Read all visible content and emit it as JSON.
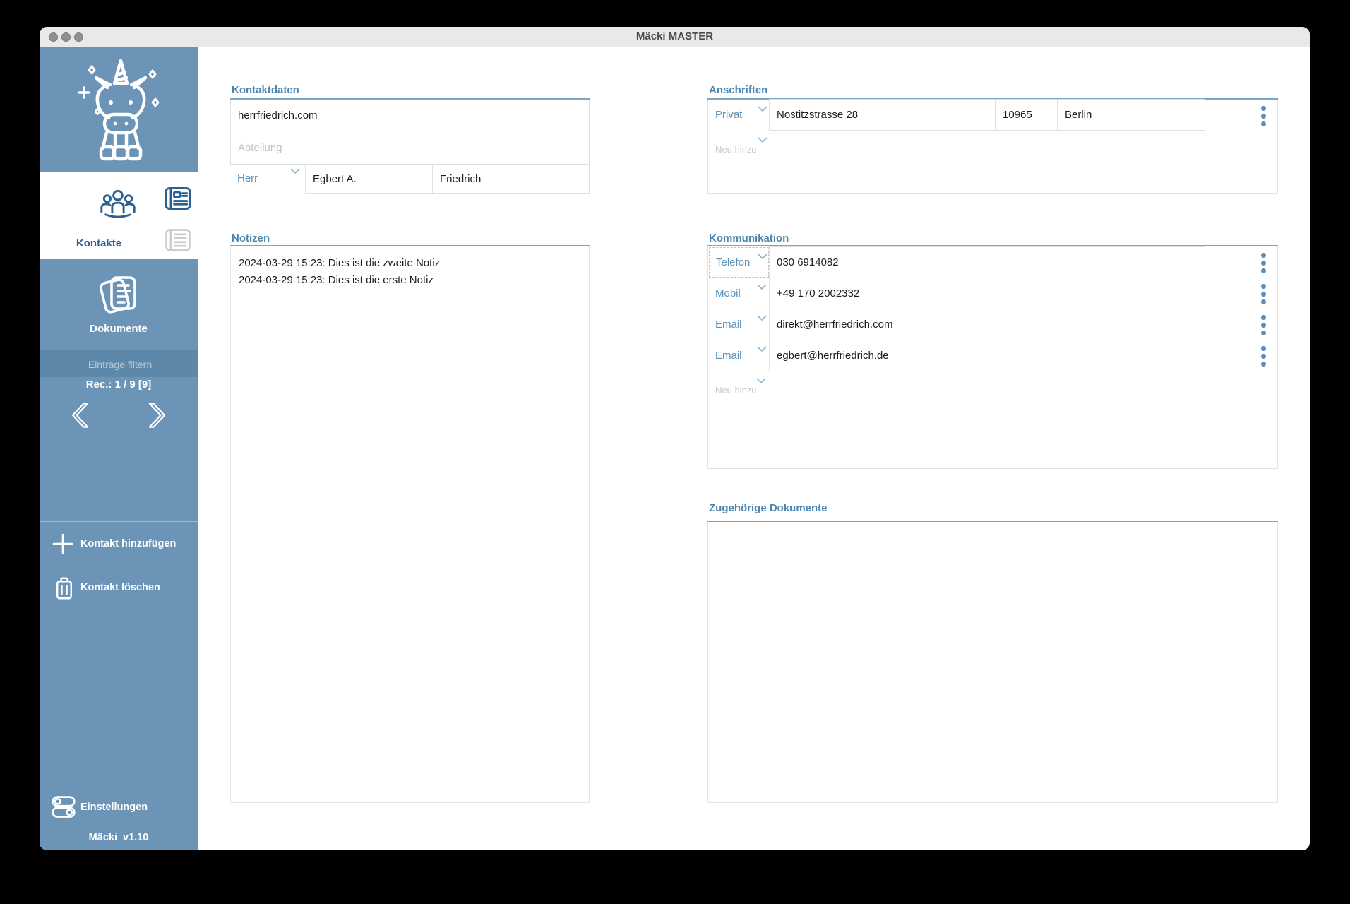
{
  "window": {
    "title": "Mäcki MASTER"
  },
  "sidebar": {
    "kontakte": {
      "label": "Kontakte",
      "icon": "people-group-icon",
      "active": true
    },
    "dokumente": {
      "label": "Dokumente",
      "icon": "documents-icon",
      "active": false
    },
    "view_icons": {
      "detail": "contact-card-icon",
      "list": "document-list-icon"
    },
    "filter_placeholder": "Einträge filtern",
    "record_counter": "Rec.: 1 / 9 [9]",
    "add_contact_label": "Kontakt hinzufügen",
    "delete_contact_label": "Kontakt löschen",
    "settings_label": "Einstellungen",
    "version": "Mäcki  v1.10",
    "logo_icon": "unicorn-logo"
  },
  "contact": {
    "section_title": "Kontaktdaten",
    "company": "herrfriedrich.com",
    "department_placeholder": "Abteilung",
    "salutation": "Herr",
    "first_name": "Egbert A.",
    "last_name": "Friedrich"
  },
  "notes": {
    "section_title": "Notizen",
    "items": [
      "2024-03-29 15:23: Dies ist die zweite Notiz",
      "2024-03-29 15:23: Dies ist die erste Notiz"
    ]
  },
  "addresses": {
    "section_title": "Anschriften",
    "rows": [
      {
        "type": "Privat",
        "street": "Nostitzstrasse 28",
        "zip": "10965",
        "city": "Berlin"
      }
    ],
    "add_label": "Neu hinzu"
  },
  "communication": {
    "section_title": "Kommunikation",
    "rows": [
      {
        "type": "Telefon",
        "value": "030 6914082"
      },
      {
        "type": "Mobil",
        "value": "+49 170 2002332"
      },
      {
        "type": "Email",
        "value": "direkt@herrfriedrich.com"
      },
      {
        "type": "Email",
        "value": "egbert@herrfriedrich.de"
      }
    ],
    "add_label": "Neu hinzu"
  },
  "documents": {
    "section_title": "Zugehörige Dokumente"
  },
  "colors": {
    "sidebar_blue": "#6b94b7",
    "bar_blue": "#5e88aa",
    "icon_blue": "#2a6092",
    "heading_blue": "#4c86b0",
    "underline_blue": "#7ba6c6",
    "label_blue": "#5a8fb8",
    "dot_blue": "#5e8fb8",
    "titlebar": "#e9e9e8",
    "title_text": "#4b4b4b",
    "traffic_light": "#909090"
  }
}
